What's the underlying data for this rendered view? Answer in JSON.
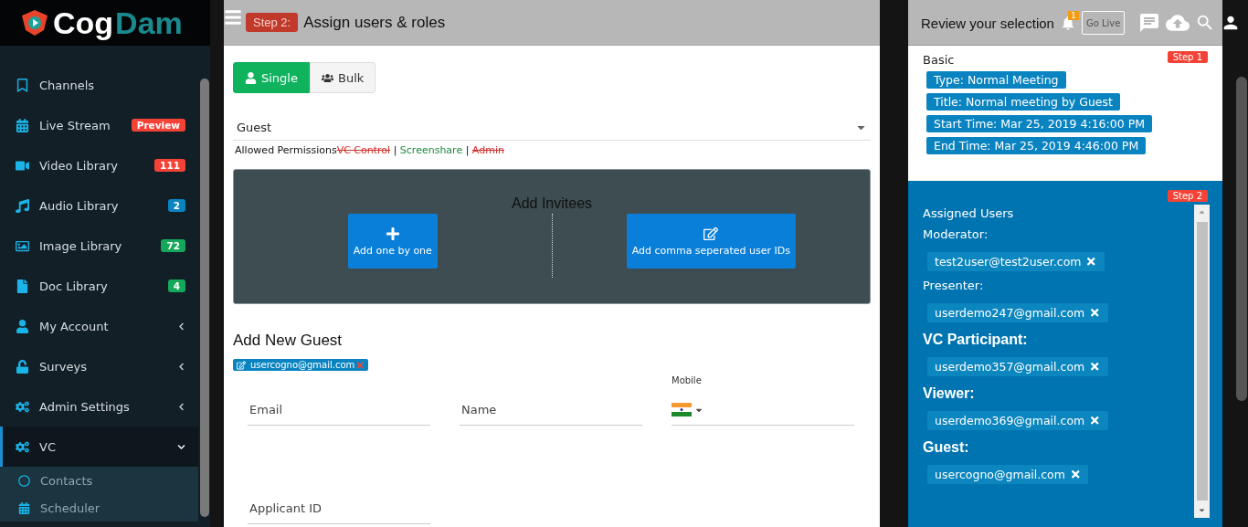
{
  "header": {
    "logo": {
      "part_1": "Cog",
      "part_2": "Dam"
    },
    "go_live": "Go Live",
    "notification_count": "1"
  },
  "sidebar": {
    "items": [
      {
        "label": "Channels",
        "selected": false
      },
      {
        "label": "Live Stream",
        "selected": false,
        "badge": {
          "text": "Preview",
          "color": "#f44336"
        }
      },
      {
        "label": "Video Library",
        "selected": false,
        "badge": {
          "text": "111",
          "color": "#f44336"
        }
      },
      {
        "label": "Audio Library",
        "selected": false,
        "badge": {
          "text": "2",
          "color": "#0a84c1"
        }
      },
      {
        "label": "Image Library",
        "selected": false,
        "badge": {
          "text": "72",
          "color": "#14a85a"
        }
      },
      {
        "label": "Doc Library",
        "selected": false,
        "badge": {
          "text": "4",
          "color": "#14a85a"
        }
      },
      {
        "label": "My Account",
        "selected": false,
        "expanded": false
      },
      {
        "label": "Surveys",
        "selected": false,
        "expanded": false
      },
      {
        "label": "Admin Settings",
        "selected": false,
        "expanded": false
      },
      {
        "label": "VC",
        "selected": true,
        "expanded": true,
        "children": [
          {
            "label": "Contacts"
          },
          {
            "label": "Scheduler"
          }
        ]
      }
    ]
  },
  "assign": {
    "step": "Step 2:",
    "title": "Assign users & roles",
    "modes": [
      {
        "label": "Single",
        "selected": true
      },
      {
        "label": "Bulk",
        "selected": false
      }
    ],
    "role_select": {
      "value": "Guest"
    },
    "permissions": {
      "label": "Allowed Permissions",
      "separator": "|",
      "items": [
        {
          "text": "VC Control",
          "allowed": false
        },
        {
          "text": "Screenshare",
          "allowed": true
        },
        {
          "text": "Admin",
          "allowed": false
        }
      ]
    },
    "invitees": {
      "title": "Add Invitees",
      "actions": [
        {
          "label": "Add one by one"
        },
        {
          "label": "Add comma seperated user IDs"
        }
      ]
    },
    "form": {
      "title": "Add New Guest",
      "chips": [
        "usercogno@gmail.com"
      ],
      "fields": [
        {
          "kind": "text",
          "placeholder": "Email"
        },
        {
          "kind": "text",
          "placeholder": "Name"
        },
        {
          "kind": "phone",
          "label": "Mobile"
        },
        {
          "kind": "text",
          "placeholder": "Applicant ID"
        }
      ]
    }
  },
  "review": {
    "title": "Review your selection",
    "basic": {
      "title": "Basic",
      "step": "Step 1",
      "tags": [
        "Type: Normal Meeting",
        "Title: Normal meeting by Guest",
        "Start Time: Mar 25, 2019 4:16:00 PM",
        "End Time: Mar 25, 2019 4:46:00 PM"
      ]
    },
    "assigned": {
      "step": "Step 2",
      "title": "Assigned Users",
      "groups": [
        {
          "role": "Moderator:",
          "kind": "minor",
          "users": [
            "test2user@test2user.com"
          ]
        },
        {
          "role": "Presenter:",
          "kind": "minor",
          "users": [
            "userdemo247@gmail.com"
          ]
        },
        {
          "role": "VC Participant:",
          "kind": "major",
          "users": [
            "userdemo357@gmail.com"
          ]
        },
        {
          "role": "Viewer:",
          "kind": "major",
          "users": [
            "userdemo369@gmail.com"
          ]
        },
        {
          "role": "Guest:",
          "kind": "major",
          "users": [
            "usercogno@gmail.com"
          ]
        }
      ]
    }
  }
}
